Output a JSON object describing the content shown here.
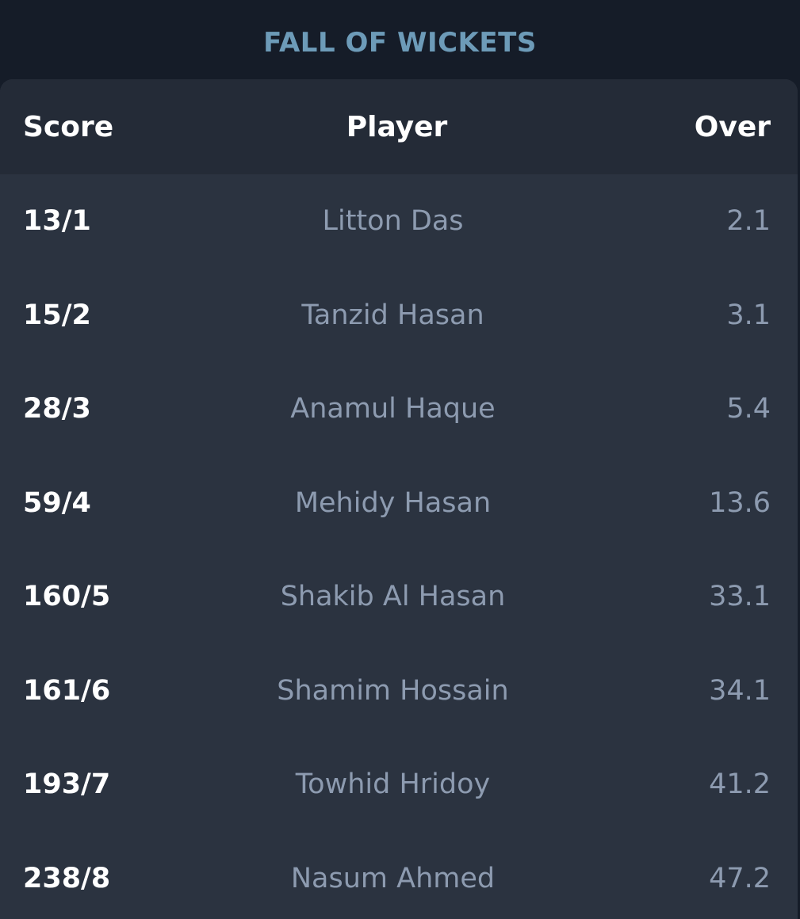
{
  "title": "FALL OF WICKETS",
  "table": {
    "headers": {
      "score": "Score",
      "player": "Player",
      "over": "Over"
    },
    "rows": [
      {
        "score": "13/1",
        "player": "Litton Das",
        "over": "2.1"
      },
      {
        "score": "15/2",
        "player": "Tanzid Hasan",
        "over": "3.1"
      },
      {
        "score": "28/3",
        "player": "Anamul Haque",
        "over": "5.4"
      },
      {
        "score": "59/4",
        "player": "Mehidy Hasan",
        "over": "13.6"
      },
      {
        "score": "160/5",
        "player": "Shakib Al Hasan",
        "over": "33.1"
      },
      {
        "score": "161/6",
        "player": "Shamim Hossain",
        "over": "34.1"
      },
      {
        "score": "193/7",
        "player": "Towhid Hridoy",
        "over": "41.2"
      },
      {
        "score": "238/8",
        "player": "Nasum Ahmed",
        "over": "47.2"
      }
    ]
  },
  "colors": {
    "background": "#151c28",
    "card": "#2b3340",
    "header": "#242b37",
    "title": "#6d9bb8",
    "muted_text": "#8d9bb0"
  }
}
